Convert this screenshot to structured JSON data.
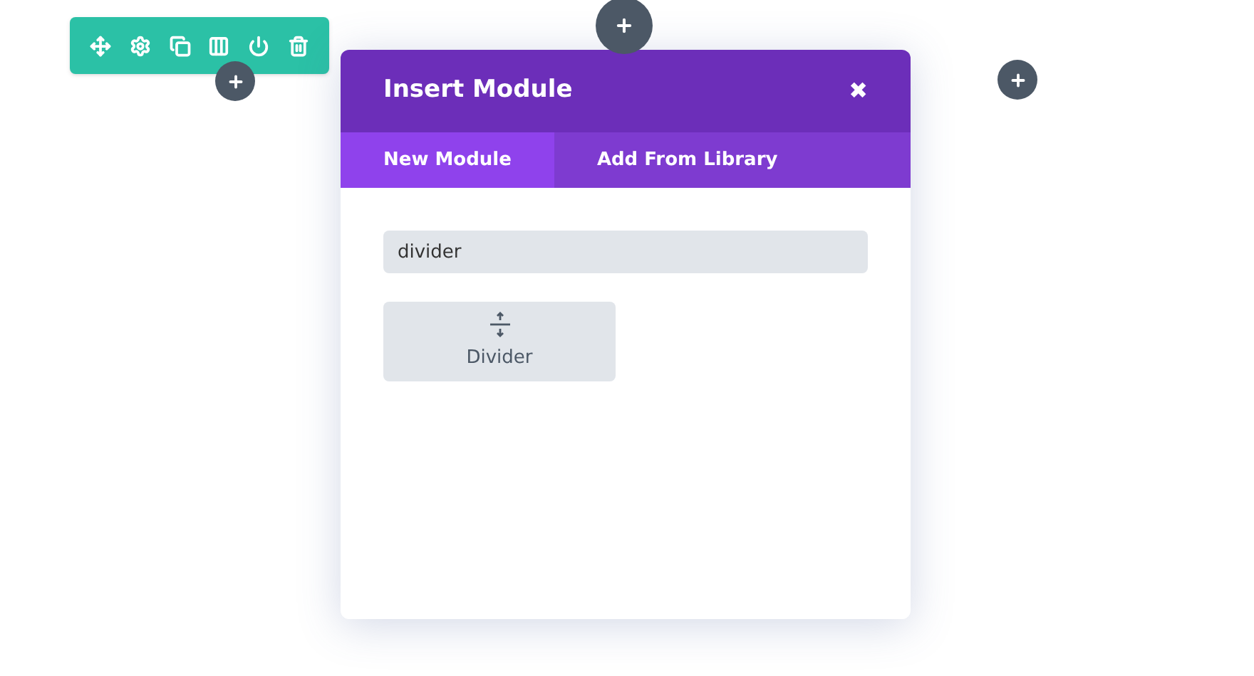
{
  "modal": {
    "title": "Insert Module",
    "close": "✖"
  },
  "tabs": [
    {
      "label": "New Module",
      "selected": true
    },
    {
      "label": "Add From Library",
      "selected": false
    }
  ],
  "search": {
    "value": "divider"
  },
  "modules": [
    {
      "label": "Divider"
    }
  ]
}
